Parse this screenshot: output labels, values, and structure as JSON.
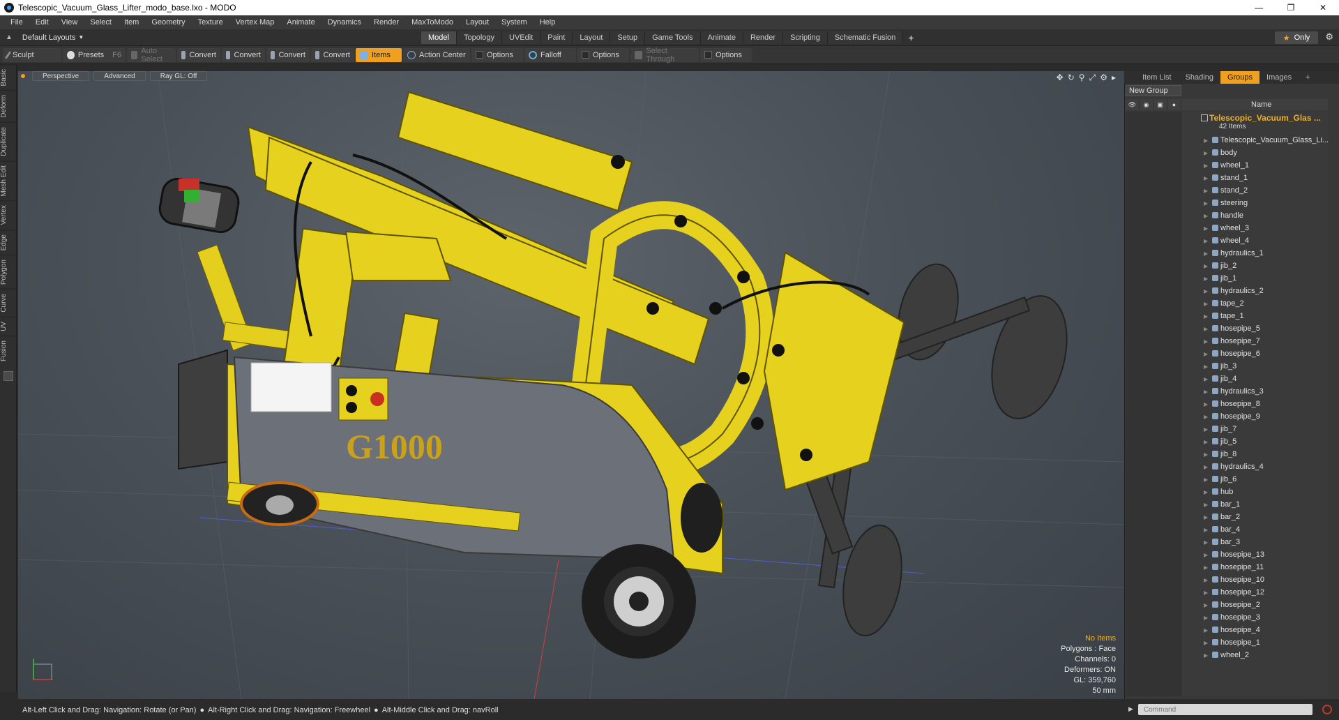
{
  "window": {
    "title": "Telescopic_Vacuum_Glass_Lifter_modo_base.lxo - MODO"
  },
  "menu": [
    "File",
    "Edit",
    "View",
    "Select",
    "Item",
    "Geometry",
    "Texture",
    "Vertex Map",
    "Animate",
    "Dynamics",
    "Render",
    "MaxToModo",
    "Layout",
    "System",
    "Help"
  ],
  "layout": {
    "label": "Default Layouts",
    "tabs": [
      "Model",
      "Topology",
      "UVEdit",
      "Paint",
      "Layout",
      "Setup",
      "Game Tools",
      "Animate",
      "Render",
      "Scripting",
      "Schematic Fusion"
    ],
    "active_tab": "Model",
    "only_label": "Only"
  },
  "toolbar": {
    "sculpt": "Sculpt",
    "presets": "Presets",
    "presets_key": "F6",
    "auto_select": "Auto Select",
    "convert1": "Convert",
    "convert2": "Convert",
    "convert3": "Convert",
    "convert4": "Convert",
    "items": "Items",
    "action_center": "Action Center",
    "options1": "Options",
    "falloff": "Falloff",
    "options2": "Options",
    "select_through": "Select Through",
    "options3": "Options"
  },
  "left_tabs": [
    "Basic",
    "Deform",
    "Duplicate",
    "Mesh Edit",
    "Vertex",
    "Edge",
    "Polygon",
    "Curve",
    "UV",
    "Fusion"
  ],
  "viewport": {
    "perspective": "Perspective",
    "advanced": "Advanced",
    "raygl": "Ray GL: Off",
    "model_label": "G1000",
    "stats": {
      "no_items": "No Items",
      "polygons": "Polygons : Face",
      "channels": "Channels: 0",
      "deformers": "Deformers: ON",
      "gl": "GL: 359,760",
      "scale": "50 mm"
    }
  },
  "status": {
    "hint1": "Alt-Left Click and Drag: Navigation: Rotate (or Pan)",
    "hint2": "Alt-Right Click and Drag: Navigation: Freewheel",
    "hint3": "Alt-Middle Click and Drag: navRoll"
  },
  "panel": {
    "tabs": [
      "Item List",
      "Shading",
      "Groups",
      "Images"
    ],
    "active_tab": "Groups",
    "new_group": "New Group",
    "name_header": "Name",
    "group_name": "Telescopic_Vacuum_Glas ...",
    "group_count": "42 Items",
    "items": [
      "Telescopic_Vacuum_Glass_Li...",
      "body",
      "wheel_1",
      "stand_1",
      "stand_2",
      "steering",
      "handle",
      "wheel_3",
      "wheel_4",
      "hydraulics_1",
      "jib_2",
      "jib_1",
      "hydraulics_2",
      "tape_2",
      "tape_1",
      "hosepipe_5",
      "hosepipe_7",
      "hosepipe_6",
      "jib_3",
      "jib_4",
      "hydraulics_3",
      "hosepipe_8",
      "hosepipe_9",
      "jib_7",
      "jib_5",
      "jib_8",
      "hydraulics_4",
      "jib_6",
      "hub",
      "bar_1",
      "bar_2",
      "bar_4",
      "bar_3",
      "hosepipe_13",
      "hosepipe_11",
      "hosepipe_10",
      "hosepipe_12",
      "hosepipe_2",
      "hosepipe_3",
      "hosepipe_4",
      "hosepipe_1",
      "wheel_2"
    ]
  },
  "command": {
    "placeholder": "Command"
  },
  "colors": {
    "accent": "#f0a020",
    "machine_yellow": "#e8d020",
    "body_gray": "#6c7078"
  }
}
